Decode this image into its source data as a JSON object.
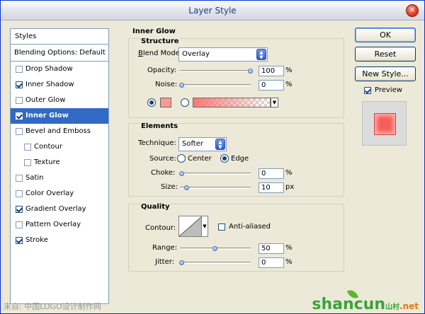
{
  "window": {
    "title": "Layer Style",
    "close_glyph": "✕"
  },
  "styles_list": {
    "header": "Styles",
    "blending": "Blending Options: Default",
    "items": [
      {
        "label": "Drop Shadow",
        "checked": false,
        "selected": false,
        "indent": false
      },
      {
        "label": "Inner Shadow",
        "checked": true,
        "selected": false,
        "indent": false
      },
      {
        "label": "Outer Glow",
        "checked": false,
        "selected": false,
        "indent": false
      },
      {
        "label": "Inner Glow",
        "checked": true,
        "selected": true,
        "indent": false
      },
      {
        "label": "Bevel and Emboss",
        "checked": false,
        "selected": false,
        "indent": false
      },
      {
        "label": "Contour",
        "checked": false,
        "selected": false,
        "indent": true
      },
      {
        "label": "Texture",
        "checked": false,
        "selected": false,
        "indent": true
      },
      {
        "label": "Satin",
        "checked": false,
        "selected": false,
        "indent": false
      },
      {
        "label": "Color Overlay",
        "checked": false,
        "selected": false,
        "indent": false
      },
      {
        "label": "Gradient Overlay",
        "checked": true,
        "selected": false,
        "indent": false
      },
      {
        "label": "Pattern Overlay",
        "checked": false,
        "selected": false,
        "indent": false
      },
      {
        "label": "Stroke",
        "checked": true,
        "selected": false,
        "indent": false
      }
    ]
  },
  "panel": {
    "title": "Inner Glow",
    "structure": {
      "title": "Structure",
      "blend_mode_label": "Blend Mode:",
      "blend_mode_value": "Overlay",
      "opacity_label": "Opacity:",
      "opacity_value": "100",
      "noise_label": "Noise:",
      "noise_value": "0",
      "percent": "%",
      "glow_color": "#f99a95"
    },
    "elements": {
      "title": "Elements",
      "technique_label": "Technique:",
      "technique_value": "Softer",
      "source_label": "Source:",
      "source_center": "Center",
      "source_edge": "Edge",
      "choke_label": "Choke:",
      "choke_value": "0",
      "size_label": "Size:",
      "size_value": "10",
      "px": "px"
    },
    "quality": {
      "title": "Quality",
      "contour_label": "Contour:",
      "anti_aliased_label": "Anti-aliased",
      "anti_aliased": false,
      "range_label": "Range:",
      "range_value": "50",
      "jitter_label": "Jitter:",
      "jitter_value": "0"
    }
  },
  "buttons": {
    "ok": "OK",
    "reset": "Reset",
    "new_style": "New Style...",
    "preview": "Preview",
    "preview_checked": true
  },
  "watermark": {
    "left": "来自: 中国LOGO设计制作网",
    "right_main": "shancun",
    "right_suffix": "山村",
    "right_tld": ".net"
  }
}
